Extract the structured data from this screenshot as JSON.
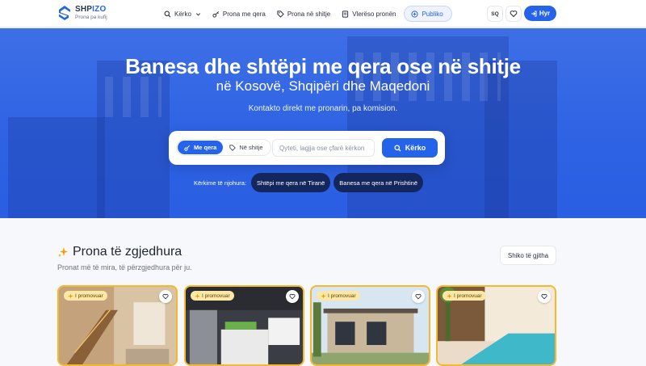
{
  "header": {
    "logo_name_part1": "SHP",
    "logo_name_part2": "IZO",
    "logo_tagline": "Prona pa kufij",
    "nav": {
      "search": "Kërko",
      "rent": "Prona me qera",
      "sale": "Prona në shitje",
      "valuation": "Vlerëso pronën",
      "publish": "Publiko"
    },
    "language": "SQ",
    "login": "Hyr"
  },
  "hero": {
    "title": "Banesa dhe shtëpi me qera ose në shitje",
    "subtitle": "në Kosovë, Shqipëri dhe Maqedoni",
    "description": "Kontakto direkt me pronarin, pa komision.",
    "search": {
      "tab_rent": "Me qera",
      "tab_sale": "Në shitje",
      "active_tab": "rent",
      "placeholder": "Qyteti, lagjja ose çfarë kërkon",
      "value": "",
      "button": "Kërko"
    },
    "popular_label": "Kërkime të njohura:",
    "popular": [
      "Shtëpi me qera në Tiranë",
      "Banesa me qera në Prishtinë"
    ]
  },
  "featured": {
    "title": "Prona të zgjedhura",
    "subtitle": "Pronat më të mira, të përzgjedhura për ju.",
    "see_all": "Shiko të gjitha",
    "cards": [
      {
        "badge": "I promovuar",
        "scene": "interior-stairs"
      },
      {
        "badge": "I promovuar",
        "scene": "kitchen"
      },
      {
        "badge": "I promovuar",
        "scene": "villa-modern"
      },
      {
        "badge": "I promovuar",
        "scene": "pool-villa"
      }
    ]
  },
  "colors": {
    "brand": "#2563eb",
    "hero_bg": "#2f63e4",
    "chip_bg": "#14265e",
    "promo_border": "#f5b82e",
    "promo_badge": "#fde7a7"
  }
}
